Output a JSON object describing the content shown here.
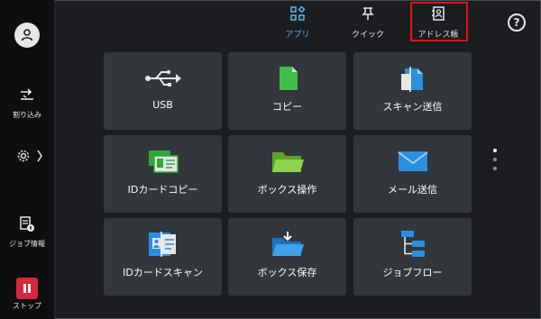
{
  "sidebar": {
    "interrupt_label": "割り込み",
    "job_info_label": "ジョブ情報",
    "stop_label": "ストップ"
  },
  "topbar": {
    "tabs": [
      {
        "label": "アプリ",
        "icon": "apps-icon",
        "active": true
      },
      {
        "label": "クイック",
        "icon": "pin-icon",
        "active": false
      },
      {
        "label": "アドレス帳",
        "icon": "address-book-icon",
        "active": false
      }
    ],
    "help_label": "?"
  },
  "apps": [
    {
      "label": "USB",
      "icon": "usb-icon"
    },
    {
      "label": "コピー",
      "icon": "copy-icon"
    },
    {
      "label": "スキャン送信",
      "icon": "scan-send-icon"
    },
    {
      "label": "IDカードコピー",
      "icon": "id-card-copy-icon"
    },
    {
      "label": "ボックス操作",
      "icon": "folder-icon"
    },
    {
      "label": "メール送信",
      "icon": "mail-icon"
    },
    {
      "label": "IDカードスキャン",
      "icon": "id-card-scan-icon"
    },
    {
      "label": "ボックス保存",
      "icon": "folder-save-icon"
    },
    {
      "label": "ジョブフロー",
      "icon": "job-flow-icon"
    }
  ],
  "colors": {
    "accent": "#5fb6ee",
    "highlight_box": "#e0141e",
    "stop": "#d9263d",
    "tile": "#33363b"
  }
}
